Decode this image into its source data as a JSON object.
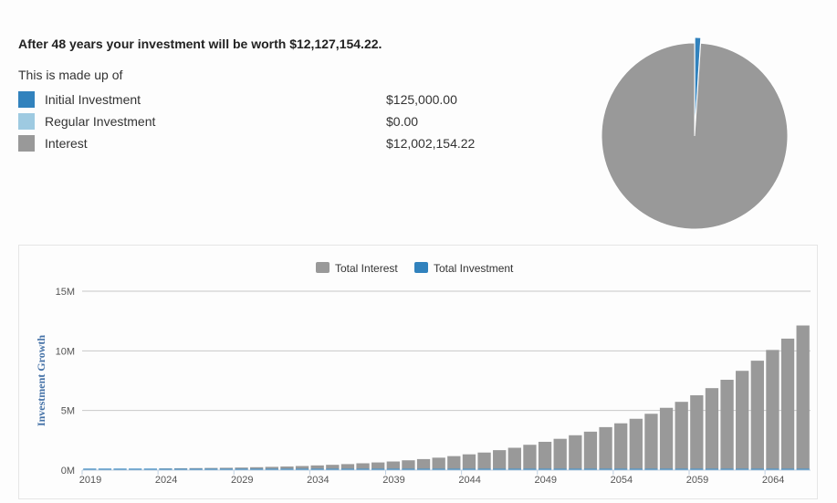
{
  "summary": {
    "headline": "After 48 years your investment will be worth $12,127,154.22.",
    "made_up_of": "This is made up of",
    "items": [
      {
        "label": "Initial Investment",
        "amount": "$125,000.00",
        "color": "#3182bd"
      },
      {
        "label": "Regular Investment",
        "amount": "$0.00",
        "color": "#9ecae1"
      },
      {
        "label": "Interest",
        "amount": "$12,002,154.22",
        "color": "#999999"
      }
    ]
  },
  "pie": {
    "slices": [
      {
        "name": "Initial Investment",
        "value": 125000.0,
        "color": "#3182bd"
      },
      {
        "name": "Regular Investment",
        "value": 0.0,
        "color": "#9ecae1"
      },
      {
        "name": "Interest",
        "value": 12002154.22,
        "color": "#999999"
      }
    ]
  },
  "chart_data": {
    "type": "bar",
    "stacked": true,
    "ylabel": "Investment Growth",
    "ylim": [
      0,
      15000000
    ],
    "y_ticks": [
      0,
      5000000,
      10000000,
      15000000
    ],
    "y_tick_labels": [
      "0M",
      "5M",
      "10M",
      "15M"
    ],
    "x_tick_labels": [
      "2019",
      "2024",
      "2029",
      "2034",
      "2039",
      "2044",
      "2049",
      "2054",
      "2059",
      "2064"
    ],
    "x_tick_years": [
      2019,
      2024,
      2029,
      2034,
      2039,
      2044,
      2049,
      2054,
      2059,
      2064
    ],
    "legend_position": "top",
    "grid": true,
    "categories": [
      2019,
      2020,
      2021,
      2022,
      2023,
      2024,
      2025,
      2026,
      2027,
      2028,
      2029,
      2030,
      2031,
      2032,
      2033,
      2034,
      2035,
      2036,
      2037,
      2038,
      2039,
      2040,
      2041,
      2042,
      2043,
      2044,
      2045,
      2046,
      2047,
      2048,
      2049,
      2050,
      2051,
      2052,
      2053,
      2054,
      2055,
      2056,
      2057,
      2058,
      2059,
      2060,
      2061,
      2062,
      2063,
      2064,
      2065,
      2066
    ],
    "series": [
      {
        "name": "Total Interest",
        "color": "#999999",
        "values": [
          0,
          0,
          0,
          0,
          0,
          23000,
          34000,
          46000,
          58000,
          73000,
          92000,
          120000,
          150000,
          180000,
          220000,
          270000,
          320000,
          380000,
          450000,
          520000,
          600000,
          700000,
          800000,
          920000,
          1050000,
          1200000,
          1350000,
          1550000,
          1750000,
          2000000,
          2250000,
          2500000,
          2800000,
          3100000,
          3480000,
          3800000,
          4180000,
          4600000,
          5100000,
          5600000,
          6150000,
          6750000,
          7450000,
          8200000,
          9050000,
          9950000,
          10900000,
          12002154.22
        ]
      },
      {
        "name": "Total Investment",
        "color": "#3182bd",
        "values": [
          125000,
          125000,
          125000,
          125000,
          125000,
          125000,
          125000,
          125000,
          125000,
          125000,
          125000,
          125000,
          125000,
          125000,
          125000,
          125000,
          125000,
          125000,
          125000,
          125000,
          125000,
          125000,
          125000,
          125000,
          125000,
          125000,
          125000,
          125000,
          125000,
          125000,
          125000,
          125000,
          125000,
          125000,
          125000,
          125000,
          125000,
          125000,
          125000,
          125000,
          125000,
          125000,
          125000,
          125000,
          125000,
          125000,
          125000,
          125000
        ]
      }
    ]
  }
}
